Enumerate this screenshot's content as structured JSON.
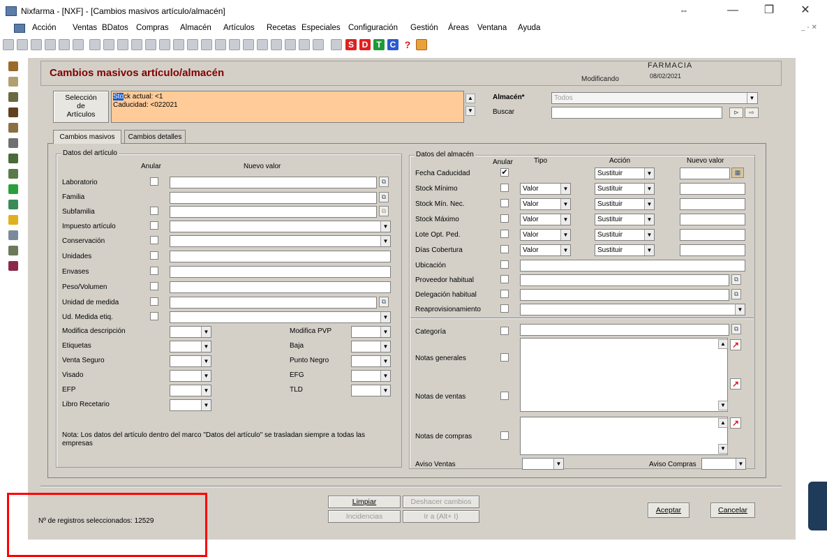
{
  "window": {
    "title": "Nixfarma - [NXF] - [Cambios masivos artículo/almacén]",
    "controls": [
      "⇔",
      "—",
      "❐",
      "✕"
    ]
  },
  "menu": [
    "Acción",
    "Ventas",
    "BDatos",
    "Compras",
    "Almacén",
    "Artículos",
    "Recetas",
    "Especiales",
    "Configuración",
    "Gestión",
    "Áreas",
    "Ventana",
    "Ayuda"
  ],
  "mdi_controls": "_ ‑ ✕",
  "toolbar": {
    "letters": [
      "S",
      "D",
      "T",
      "C",
      "?"
    ],
    "colors": {
      "S": "#e02020",
      "D": "#e02020",
      "T": "#1f9a3a",
      "C": "#2a5ad0"
    }
  },
  "header": {
    "title": "Cambios masivos artículo/almacén",
    "brand": "FARMACIA",
    "status": "Modificando",
    "date": "08/02/2021"
  },
  "selection": {
    "button": "Selección\nde\nArtículos",
    "line1_highlight": "Sto",
    "line1_rest": "ck actual: <1",
    "line2": "Caducidad: <022021"
  },
  "almacen": {
    "label": "Almacén*",
    "value": "Todos",
    "buscar_label": "Buscar"
  },
  "tabs": [
    "Cambios masivos",
    "Cambios detalles"
  ],
  "articulo": {
    "group_title": "Datos del artículo",
    "col_anular": "Anular",
    "col_nuevo": "Nuevo valor",
    "rows": [
      "Laboratorio",
      "Familia",
      "Subfamilia",
      "Impuesto artículo",
      "Conservación",
      "Unidades",
      "Envases",
      "Peso/Volumen",
      "Unidad de medida",
      "Ud. Medida etiq."
    ],
    "lower_left": [
      "Modifica descripción",
      "Etiquetas",
      "Venta Seguro",
      "Visado",
      "EFP",
      "Libro Recetario"
    ],
    "lower_right": [
      "Modifica PVP",
      "Baja",
      "Punto Negro",
      "EFG",
      "TLD"
    ],
    "note": "Nota: Los datos del artículo dentro del marco \"Datos del artículo\" se trasladan siempre a todas las empresas"
  },
  "almacen_data": {
    "group_title": "Datos del almacén",
    "col_anular": "Anular",
    "col_tipo": "Tipo",
    "col_accion": "Acción",
    "col_nuevo": "Nuevo valor",
    "rows": [
      {
        "label": "Fecha Caducidad",
        "checked": "✔",
        "tipo": "",
        "accion": "Sustituir"
      },
      {
        "label": "Stock Mínimo",
        "checked": "",
        "tipo": "Valor",
        "accion": "Sustituir"
      },
      {
        "label": "Stock Mín. Nec.",
        "checked": "",
        "tipo": "Valor",
        "accion": "Sustituir"
      },
      {
        "label": "Stock Máximo",
        "checked": "",
        "tipo": "Valor",
        "accion": "Sustituir"
      },
      {
        "label": "Lote Opt. Ped.",
        "checked": "",
        "tipo": "Valor",
        "accion": "Sustituir"
      },
      {
        "label": "Días Cobertura",
        "checked": "",
        "tipo": "Valor",
        "accion": "Sustituir"
      }
    ],
    "ubicacion": "Ubicación",
    "proveedor": "Proveedor habitual",
    "delegacion": "Delegación habitual",
    "reaprov": "Reaprovisionamiento",
    "categoria": "Categoría",
    "notas_generales": "Notas generales",
    "notas_ventas": "Notas de ventas",
    "notas_compras": "Notas de compras",
    "aviso_ventas": "Aviso Ventas",
    "aviso_compras": "Aviso Compras"
  },
  "footer": {
    "limpiar": "Limpiar",
    "deshacer": "Deshacer cambios",
    "incidencias": "Incidencias",
    "ir_a": "Ir a (Alt+ I)",
    "aceptar": "Aceptar",
    "cancelar": "Cancelar",
    "registros": "Nº de registros seleccionados: 12529"
  }
}
